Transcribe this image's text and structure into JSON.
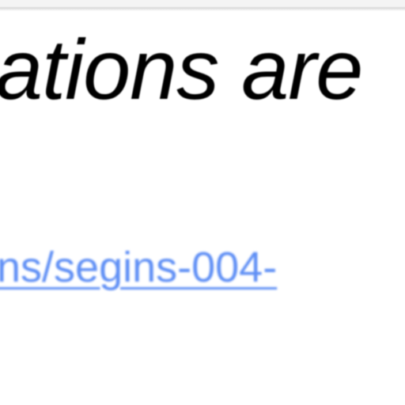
{
  "page": {
    "heading_text": "ations are",
    "link_text": "ns/segins-004-"
  },
  "colors": {
    "background": "#ffffff",
    "heading": "#000000",
    "link": "#5f8ff5",
    "divider": "#d9d9d9"
  }
}
